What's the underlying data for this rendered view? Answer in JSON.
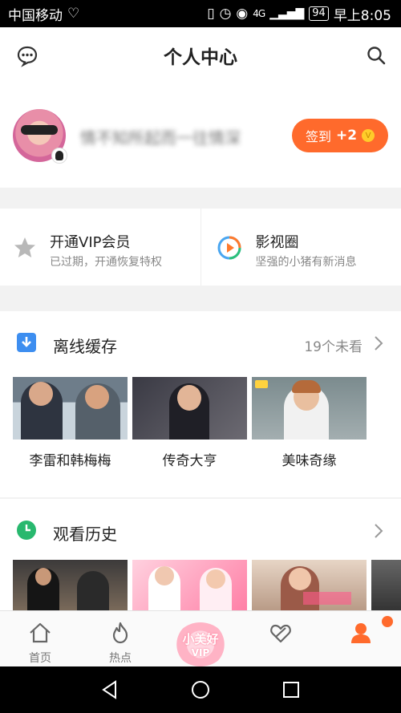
{
  "status_bar": {
    "carrier": "中国移动",
    "network": "4G",
    "battery": "94",
    "time": "早上8:05"
  },
  "header": {
    "title": "个人中心"
  },
  "profile": {
    "username": "情不知所起而一往情深",
    "signin_label": "签到",
    "signin_points": "+2",
    "coin_symbol": "V"
  },
  "cards": {
    "vip": {
      "title": "开通VIP会员",
      "subtitle": "已过期，开通恢复特权",
      "icon": "star-icon"
    },
    "circle": {
      "title": "影视圈",
      "subtitle": "坚强的小猪有新消息",
      "icon": "play-circle-icon"
    }
  },
  "offline": {
    "title": "离线缓存",
    "unwatched": "19个未看",
    "items": [
      {
        "caption": "李雷和韩梅梅"
      },
      {
        "caption": "传奇大亨"
      },
      {
        "caption": "美味奇缘"
      }
    ]
  },
  "history": {
    "title": "观看历史"
  },
  "tabbar": {
    "items": [
      {
        "label": "首页",
        "icon": "home-icon"
      },
      {
        "label": "热点",
        "icon": "flame-icon"
      },
      {
        "label": "",
        "icon": "vip-badge-icon",
        "badge_line1": "小美好",
        "badge_line2": "VIP"
      },
      {
        "label": "",
        "icon": "heart-circle-icon"
      },
      {
        "label": "",
        "icon": "user-icon"
      }
    ]
  },
  "colors": {
    "accent": "#ff6a2c",
    "offline_icon": "#3d8ef0",
    "history_icon": "#28b86e"
  }
}
